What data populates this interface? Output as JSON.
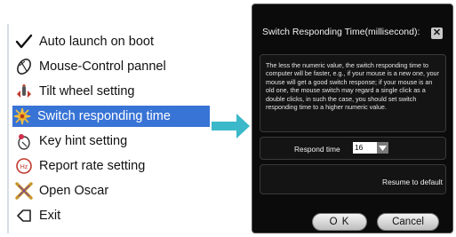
{
  "menu": {
    "items": [
      {
        "label": "Auto launch on boot",
        "icon": "checkmark-icon"
      },
      {
        "label": "Mouse-Control pannel",
        "icon": "mouse-icon"
      },
      {
        "label": "Tilt wheel setting",
        "icon": "tilt-wheel-icon"
      },
      {
        "label": "Switch responding time",
        "icon": "switch-time-icon",
        "highlighted": true
      },
      {
        "label": "Key hint setting",
        "icon": "key-hint-icon"
      },
      {
        "label": "Report rate setting",
        "icon": "report-rate-icon"
      },
      {
        "label": "Open Oscar",
        "icon": "oscar-icon"
      },
      {
        "label": "Exit",
        "icon": "exit-icon"
      }
    ],
    "report_icon_text": "Hz"
  },
  "dialog": {
    "title": "Switch Responding Time(millisecond):",
    "close_label": "✕",
    "description": "The less the numeric value, the switch responding time to computer will be faster, e.g., if your mouse is a new one, your mouse will get a good switch response; if your mouse is an old one, the mouse switch may regard a single click as a double clicks, in such the case, you should set switch responding time to a higher numeric value.",
    "respond_label": "Respond time",
    "respond_value": "16",
    "resume_label": "Resume to default",
    "ok_label": "O K",
    "cancel_label": "Cancel"
  },
  "colors": {
    "highlight": "#3873d6",
    "arrow": "#3bb8c9",
    "dialog_bg": "#0b0b0b"
  }
}
